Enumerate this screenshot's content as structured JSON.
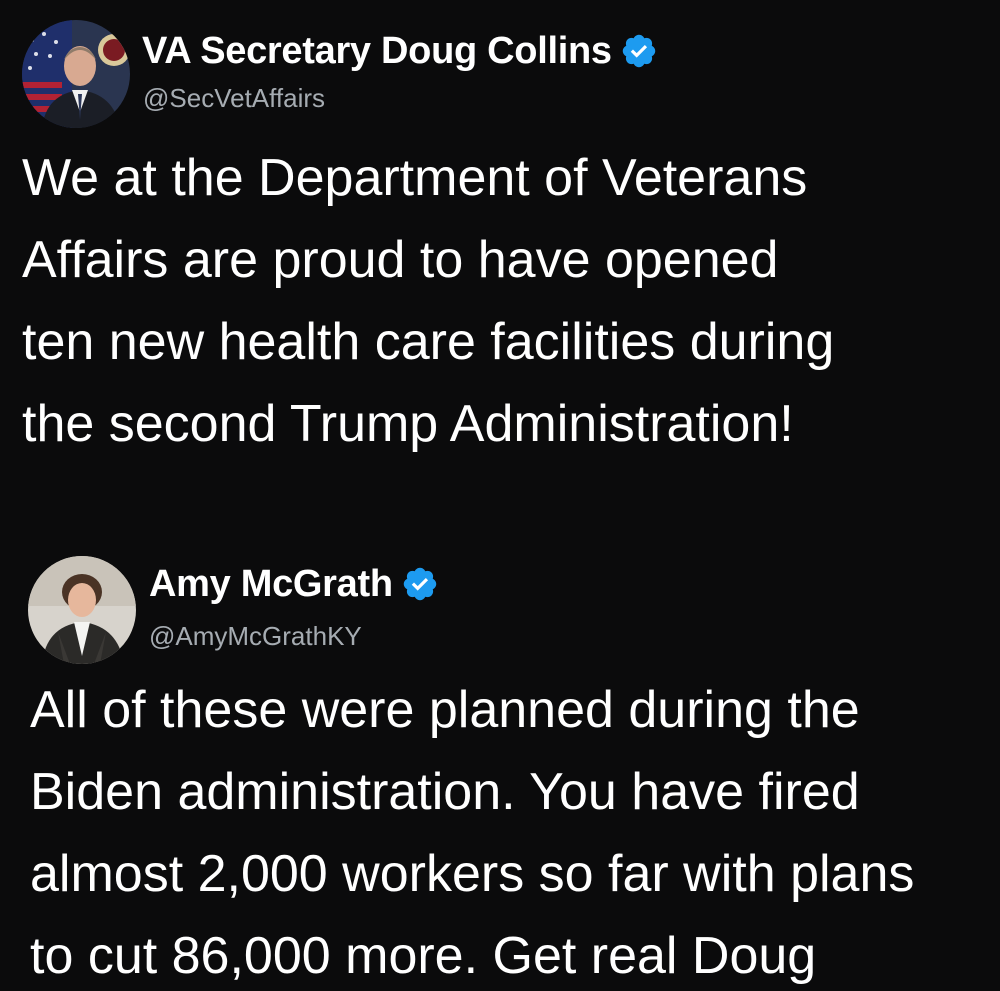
{
  "tweets": [
    {
      "display_name": "VA Secretary Doug Collins",
      "handle": "@SecVetAffairs",
      "verified": true,
      "verified_color": "#1d9bf0",
      "avatar_icon": "profile-photo-man-in-suit-with-flag",
      "lines": [
        "We at the Department of Veterans",
        "Affairs are proud to have opened",
        "ten new health care facilities during",
        "the second Trump Administration!"
      ]
    },
    {
      "display_name": "Amy McGrath",
      "handle": "@AmyMcGrathKY",
      "verified": true,
      "verified_color": "#1d9bf0",
      "avatar_icon": "profile-photo-woman-in-jacket",
      "lines": [
        "All of these were planned during the",
        "Biden administration. You have fired",
        "almost 2,000 workers so far with plans",
        "to cut 86,000 more. Get real Doug"
      ]
    }
  ],
  "colors": {
    "background": "#0b0b0c",
    "text": "#ffffff",
    "handle": "#a6acb2",
    "verified": "#1d9bf0"
  }
}
